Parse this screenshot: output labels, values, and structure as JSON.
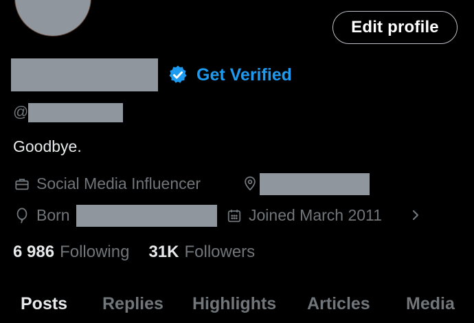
{
  "profile": {
    "edit_label": "Edit profile",
    "verified_label": "Get Verified",
    "handle_prefix": "@",
    "bio": "Goodbye.",
    "category": "Social Media Influencer",
    "born_label": "Born",
    "joined": "Joined March 2011",
    "following_count": "6 986",
    "following_label": "Following",
    "followers_count": "31K",
    "followers_label": "Followers"
  },
  "tabs": [
    {
      "label": "Posts",
      "active": true
    },
    {
      "label": "Replies",
      "active": false
    },
    {
      "label": "Highlights",
      "active": false
    },
    {
      "label": "Articles",
      "active": false
    },
    {
      "label": "Media",
      "active": false
    }
  ],
  "colors": {
    "background": "#000000",
    "accent": "#1d9bf0",
    "muted": "#71767b",
    "text": "#e7e9ea",
    "redaction": "#8f969e"
  },
  "icons": [
    "verified-badge-icon",
    "briefcase-icon",
    "location-pin-icon",
    "balloon-icon",
    "calendar-icon",
    "chevron-right-icon"
  ]
}
